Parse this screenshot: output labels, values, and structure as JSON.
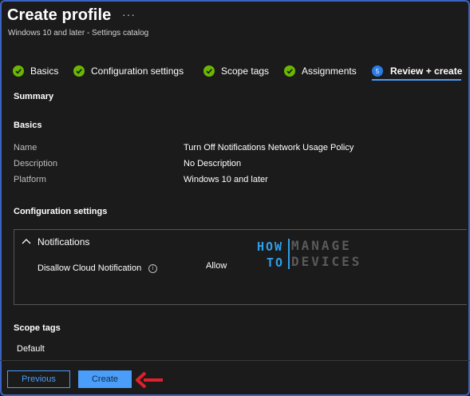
{
  "header": {
    "title": "Create profile",
    "more": "···",
    "subtitle": "Windows 10 and later - Settings catalog"
  },
  "steps": [
    {
      "label": "Basics",
      "state": "done"
    },
    {
      "label": "Configuration settings",
      "state": "done"
    },
    {
      "label": "Scope tags",
      "state": "done"
    },
    {
      "label": "Assignments",
      "state": "done"
    },
    {
      "label": "Review + create",
      "state": "active",
      "number": "5"
    }
  ],
  "summary": {
    "heading": "Summary",
    "basics": {
      "heading": "Basics",
      "rows": [
        {
          "label": "Name",
          "value": "Turn Off Notifications Network Usage Policy"
        },
        {
          "label": "Description",
          "value": "No Description"
        },
        {
          "label": "Platform",
          "value": "Windows 10 and later"
        }
      ]
    },
    "configuration": {
      "heading": "Configuration settings",
      "category": "Notifications",
      "setting_name": "Disallow Cloud Notification",
      "setting_value": "Allow"
    },
    "scope_tags": {
      "heading": "Scope tags",
      "value": "Default"
    }
  },
  "logo": {
    "how": "HOW",
    "to": "TO",
    "manage": "MANAGE",
    "devices": "DEVICES"
  },
  "footer": {
    "previous_label": "Previous",
    "create_label": "Create"
  },
  "colors": {
    "background": "#1b1b1b",
    "accent": "#4a9df8",
    "success": "#6bb700",
    "frame": "#3b63c4",
    "annotation_arrow": "#e0202a"
  }
}
